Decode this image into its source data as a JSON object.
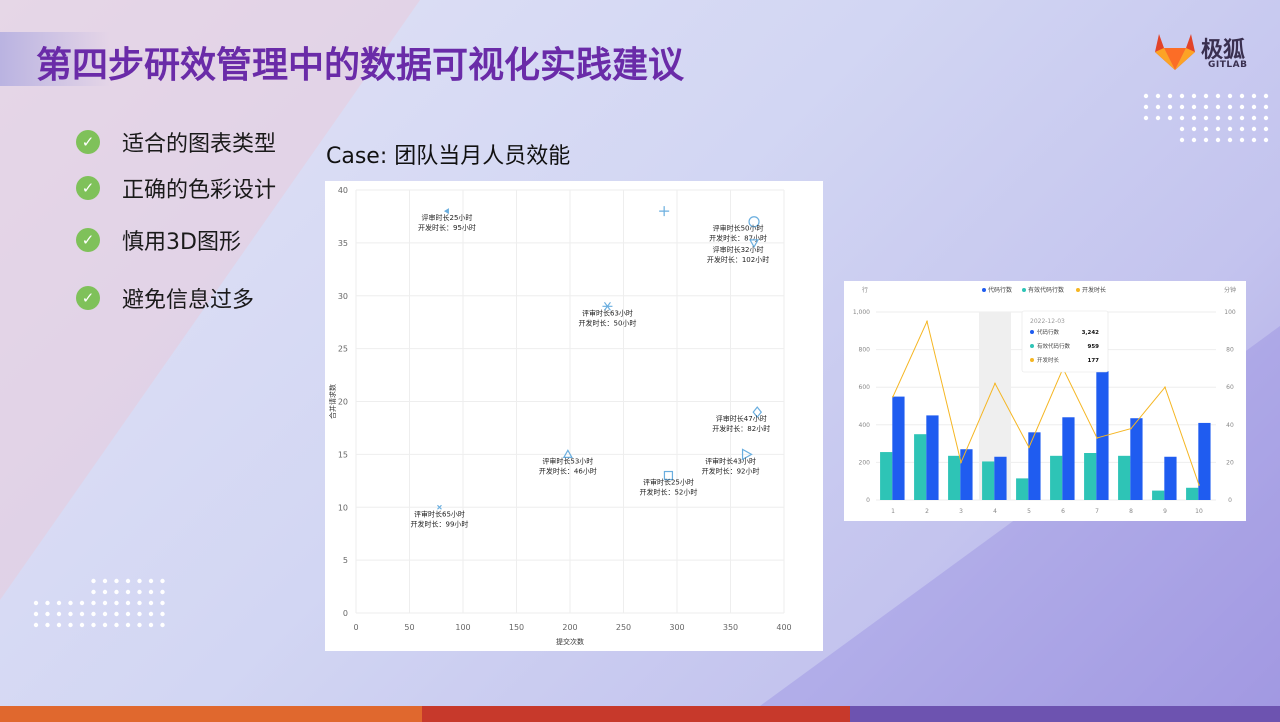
{
  "slide": {
    "title": "第四步研效管理中的数据可视化实践建议",
    "logo": {
      "name": "极狐",
      "sub": "GITLAB",
      "colors": [
        "#e24329",
        "#fc6d26",
        "#fca326"
      ]
    },
    "checklist": [
      "适合的图表类型",
      "正确的色彩设计",
      "慎用3D图形",
      "避免信息过多"
    ],
    "case_title": "Case: 团队当月人员效能"
  },
  "chart_data": [
    {
      "type": "scatter",
      "xlabel": "提交次数",
      "ylabel": "合并请求数",
      "xlim": [
        0,
        400
      ],
      "ylim": [
        0,
        40
      ],
      "xticks": [
        0,
        50,
        100,
        150,
        200,
        250,
        300,
        350,
        400
      ],
      "yticks": [
        0,
        5,
        10,
        15,
        20,
        25,
        30,
        35,
        40
      ],
      "grid": true,
      "points": [
        {
          "x": 85,
          "y": 38,
          "marker": "triangle-left",
          "review": "评审时长25小时",
          "dev": "开发时长：95小时"
        },
        {
          "x": 288,
          "y": 38,
          "marker": "cross",
          "review": "",
          "dev": ""
        },
        {
          "x": 372,
          "y": 37,
          "marker": "circle",
          "review": "评审时长50小时",
          "dev": "开发时长：87小时"
        },
        {
          "x": 372,
          "y": 35,
          "marker": "triangle-down",
          "review": "评审时长32小时",
          "dev": "开发时长：102小时"
        },
        {
          "x": 235,
          "y": 29,
          "marker": "asterisk",
          "review": "评审时长63小时",
          "dev": "开发时长：50小时"
        },
        {
          "x": 375,
          "y": 19,
          "marker": "diamond",
          "review": "评审时长47小时",
          "dev": "开发时长：82小时"
        },
        {
          "x": 198,
          "y": 15,
          "marker": "triangle-up",
          "review": "评审时长53小时",
          "dev": "开发时长：46小时"
        },
        {
          "x": 365,
          "y": 15,
          "marker": "triangle-right",
          "review": "评审时长43小时",
          "dev": "开发时长：92小时"
        },
        {
          "x": 292,
          "y": 13,
          "marker": "square",
          "review": "评审时长25小时",
          "dev": "开发时长：52小时"
        },
        {
          "x": 78,
          "y": 10,
          "marker": "x",
          "review": "评审时长65小时",
          "dev": "开发时长：99小时"
        }
      ],
      "color": "#6aaedf"
    },
    {
      "type": "bar",
      "categories": [
        "1",
        "2",
        "3",
        "4",
        "5",
        "6",
        "7",
        "8",
        "9",
        "10"
      ],
      "legend": [
        "代码行数",
        "有效代码行数",
        "开发时长"
      ],
      "legend_position": "top-right",
      "left_axis_label": "行",
      "right_axis_label": "分钟",
      "left_ticks": [
        "0",
        "200",
        "400",
        "600",
        "800",
        "1,000"
      ],
      "right_ticks": [
        "0",
        "20",
        "40",
        "60",
        "80",
        "100"
      ],
      "ylim_left": [
        0,
        1000
      ],
      "ylim_right": [
        0,
        100
      ],
      "series": [
        {
          "name": "有效代码行数",
          "color": "#2ec4b6",
          "values": [
            255,
            350,
            235,
            205,
            115,
            235,
            250,
            235,
            50,
            65
          ]
        },
        {
          "name": "代码行数",
          "color": "#1f5cf0",
          "values": [
            550,
            450,
            270,
            230,
            360,
            440,
            685,
            435,
            230,
            410
          ]
        },
        {
          "name": "开发时长",
          "color": "#f5b623",
          "values": [
            55,
            95,
            20,
            62,
            28,
            70,
            33,
            38,
            60,
            8
          ],
          "type": "line",
          "axis": "right"
        }
      ],
      "highlight_category": "4",
      "tooltip": {
        "date": "2022-12-03",
        "rows": [
          {
            "label": "代码行数",
            "value": "3,242",
            "color": "#1f5cf0"
          },
          {
            "label": "有效代码行数",
            "value": "959",
            "color": "#2ec4b6"
          },
          {
            "label": "开发时长",
            "value": "177",
            "color": "#f5b623"
          }
        ]
      }
    }
  ],
  "colors": {
    "title": "#6a2ba8",
    "check": "#7fc15a",
    "bottom_bar": [
      "#e0682e",
      "#c7392b",
      "#6d53b0"
    ]
  }
}
